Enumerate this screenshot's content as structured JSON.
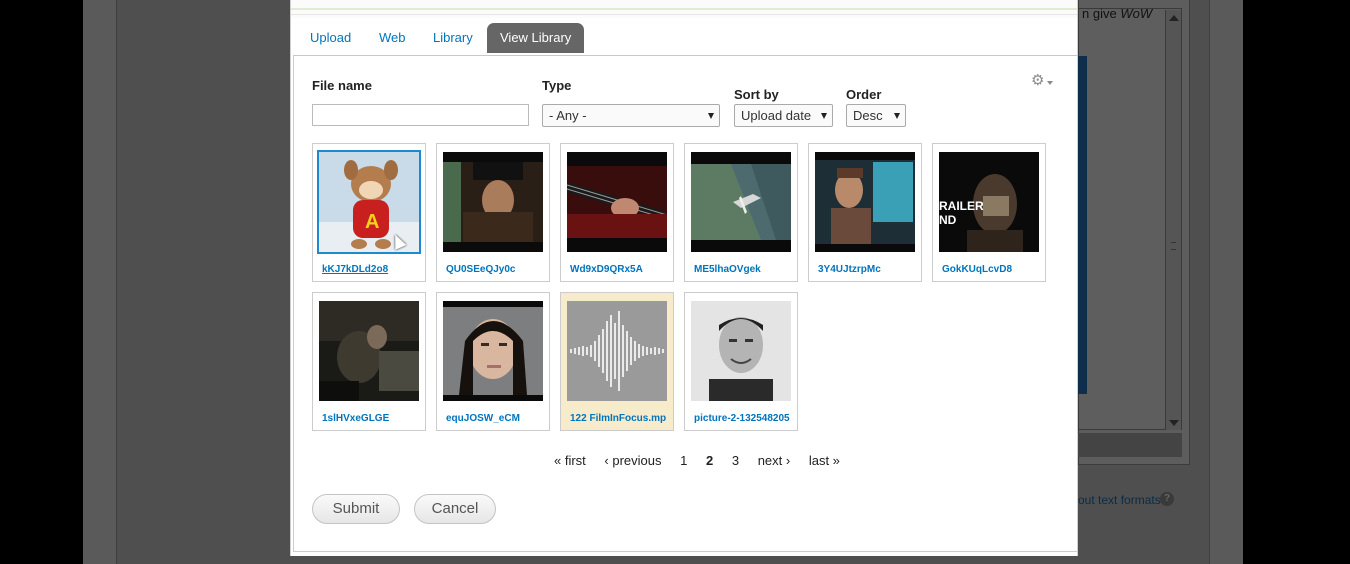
{
  "background": {
    "top_text": "n give",
    "top_text_em": "WoW",
    "formats_link": "out text formats",
    "help_glyph": "?"
  },
  "tabs": [
    {
      "label": "Upload",
      "active": false
    },
    {
      "label": "Web",
      "active": false
    },
    {
      "label": "Library",
      "active": false
    },
    {
      "label": "View Library",
      "active": true
    }
  ],
  "filters": {
    "file_name_label": "File name",
    "file_name_value": "",
    "type_label": "Type",
    "type_value": "- Any -",
    "sort_label": "Sort by",
    "sort_value": "Upload date",
    "order_label": "Order",
    "order_value": "Desc",
    "settings_icon": "gear-icon"
  },
  "items": [
    {
      "name": "kKJ7kDLd2o8",
      "selected": true,
      "kind": "video"
    },
    {
      "name": "QU0SEeQJy0c",
      "selected": false,
      "kind": "video"
    },
    {
      "name": "Wd9xD9QRx5A",
      "selected": false,
      "kind": "video"
    },
    {
      "name": "ME5lhaOVgek",
      "selected": false,
      "kind": "video"
    },
    {
      "name": "3Y4UJtzrpMc",
      "selected": false,
      "kind": "video"
    },
    {
      "name": "GokKUqLcvD8",
      "selected": false,
      "kind": "video",
      "overlay": "RAILER"
    },
    {
      "name": "1slHVxeGLGE",
      "selected": false,
      "kind": "video"
    },
    {
      "name": "equJOSW_eCM",
      "selected": false,
      "kind": "video"
    },
    {
      "name": "122 FilmInFocus.mp",
      "selected": false,
      "kind": "audio"
    },
    {
      "name": "picture-2-132548205",
      "selected": false,
      "kind": "image"
    }
  ],
  "pager": {
    "first": "« first",
    "previous": "‹ previous",
    "pages": [
      "1",
      "2",
      "3"
    ],
    "current": "2",
    "next": "next ›",
    "last": "last »"
  },
  "actions": {
    "submit": "Submit",
    "cancel": "Cancel"
  },
  "colors": {
    "link": "#0074bd",
    "active_tab": "#666666",
    "selected_border": "#1e88d0",
    "audio_bg": "#f6eccb"
  }
}
